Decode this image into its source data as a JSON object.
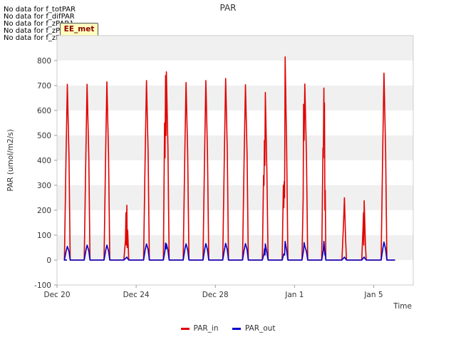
{
  "notices": [
    "No data for f_totPAR",
    "No data for f_difPAR",
    "No data for f_zPAR1",
    "No data for f_zPAR2",
    "No data for f_zPAR3"
  ],
  "badge": "EE_met",
  "chart_data": {
    "type": "line",
    "title": "PAR",
    "xlabel": "Time",
    "ylabel": "PAR (umol/m2/s)",
    "xlim": [
      "2022-12-20",
      "2023-01-07"
    ],
    "ylim": [
      -100,
      900
    ],
    "yticks": [
      -100,
      0,
      100,
      200,
      300,
      400,
      500,
      600,
      700,
      800
    ],
    "xticks": [
      {
        "date": "2022-12-20",
        "label": "Dec 20"
      },
      {
        "date": "2022-12-24",
        "label": "Dec 24"
      },
      {
        "date": "2022-12-28",
        "label": "Dec 28"
      },
      {
        "date": "2023-01-01",
        "label": "Jan 1"
      },
      {
        "date": "2023-01-05",
        "label": "Jan 5"
      }
    ],
    "grid": "horizontal bands",
    "legend_position": "bottom",
    "series": [
      {
        "name": "PAR_in",
        "color": "#e00000",
        "points": [
          [
            "2022-12-20 09:00",
            0
          ],
          [
            "2022-12-20 11:00",
            420
          ],
          [
            "2022-12-20 12:30",
            705
          ],
          [
            "2022-12-20 14:30",
            420
          ],
          [
            "2022-12-20 16:00",
            0
          ],
          [
            "2022-12-21 09:00",
            0
          ],
          [
            "2022-12-21 11:00",
            420
          ],
          [
            "2022-12-21 12:30",
            705
          ],
          [
            "2022-12-21 14:30",
            420
          ],
          [
            "2022-12-21 16:00",
            0
          ],
          [
            "2022-12-22 09:00",
            0
          ],
          [
            "2022-12-22 11:00",
            430
          ],
          [
            "2022-12-22 12:30",
            715
          ],
          [
            "2022-12-22 14:30",
            430
          ],
          [
            "2022-12-22 16:00",
            0
          ],
          [
            "2022-12-23 09:00",
            0
          ],
          [
            "2022-12-23 11:00",
            80
          ],
          [
            "2022-12-23 11:40",
            190
          ],
          [
            "2022-12-23 12:10",
            60
          ],
          [
            "2022-12-23 12:40",
            220
          ],
          [
            "2022-12-23 13:10",
            50
          ],
          [
            "2022-12-23 13:40",
            120
          ],
          [
            "2022-12-23 15:00",
            0
          ],
          [
            "2022-12-24 09:00",
            0
          ],
          [
            "2022-12-24 11:00",
            430
          ],
          [
            "2022-12-24 12:30",
            720
          ],
          [
            "2022-12-24 14:30",
            430
          ],
          [
            "2022-12-24 16:00",
            0
          ],
          [
            "2022-12-25 09:00",
            0
          ],
          [
            "2022-12-25 10:30",
            550
          ],
          [
            "2022-12-25 11:00",
            410
          ],
          [
            "2022-12-25 11:40",
            740
          ],
          [
            "2022-12-25 12:10",
            500
          ],
          [
            "2022-12-25 12:40",
            755
          ],
          [
            "2022-12-25 14:30",
            450
          ],
          [
            "2022-12-25 16:00",
            0
          ],
          [
            "2022-12-26 09:00",
            0
          ],
          [
            "2022-12-26 11:00",
            430
          ],
          [
            "2022-12-26 12:30",
            712
          ],
          [
            "2022-12-26 14:30",
            430
          ],
          [
            "2022-12-26 16:00",
            0
          ],
          [
            "2022-12-27 09:00",
            0
          ],
          [
            "2022-12-27 11:00",
            430
          ],
          [
            "2022-12-27 12:30",
            720
          ],
          [
            "2022-12-27 14:30",
            430
          ],
          [
            "2022-12-27 16:00",
            0
          ],
          [
            "2022-12-28 09:00",
            0
          ],
          [
            "2022-12-28 11:00",
            440
          ],
          [
            "2022-12-28 12:30",
            728
          ],
          [
            "2022-12-28 14:30",
            440
          ],
          [
            "2022-12-28 16:00",
            0
          ],
          [
            "2022-12-29 09:00",
            0
          ],
          [
            "2022-12-29 11:00",
            420
          ],
          [
            "2022-12-29 12:30",
            703
          ],
          [
            "2022-12-29 14:30",
            420
          ],
          [
            "2022-12-29 16:00",
            0
          ],
          [
            "2022-12-30 09:00",
            0
          ],
          [
            "2022-12-30 10:30",
            340
          ],
          [
            "2022-12-30 11:00",
            300
          ],
          [
            "2022-12-30 11:30",
            480
          ],
          [
            "2022-12-30 12:00",
            380
          ],
          [
            "2022-12-30 12:40",
            672
          ],
          [
            "2022-12-30 14:30",
            350
          ],
          [
            "2022-12-30 16:00",
            0
          ],
          [
            "2022-12-31 09:00",
            0
          ],
          [
            "2022-12-31 10:30",
            300
          ],
          [
            "2022-12-31 11:00",
            210
          ],
          [
            "2022-12-31 11:30",
            315
          ],
          [
            "2022-12-31 12:00",
            250
          ],
          [
            "2022-12-31 12:40",
            815
          ],
          [
            "2022-12-31 14:30",
            450
          ],
          [
            "2022-12-31 16:00",
            0
          ],
          [
            "2023-01-01 09:00",
            0
          ],
          [
            "2023-01-01 10:30",
            250
          ],
          [
            "2023-01-01 11:00",
            625
          ],
          [
            "2023-01-01 11:40",
            480
          ],
          [
            "2023-01-01 12:30",
            706
          ],
          [
            "2023-01-01 14:30",
            420
          ],
          [
            "2023-01-01 16:00",
            0
          ],
          [
            "2023-01-02 09:00",
            0
          ],
          [
            "2023-01-02 10:30",
            450
          ],
          [
            "2023-01-02 11:00",
            410
          ],
          [
            "2023-01-02 11:40",
            690
          ],
          [
            "2023-01-02 12:00",
            460
          ],
          [
            "2023-01-02 12:20",
            630
          ],
          [
            "2023-01-02 12:50",
            200
          ],
          [
            "2023-01-02 13:20",
            280
          ],
          [
            "2023-01-02 14:00",
            0
          ],
          [
            "2023-01-03 09:30",
            0
          ],
          [
            "2023-01-03 11:30",
            150
          ],
          [
            "2023-01-03 12:30",
            250
          ],
          [
            "2023-01-03 14:00",
            80
          ],
          [
            "2023-01-03 15:00",
            0
          ],
          [
            "2023-01-04 09:30",
            0
          ],
          [
            "2023-01-04 11:00",
            120
          ],
          [
            "2023-01-04 11:40",
            190
          ],
          [
            "2023-01-04 12:00",
            60
          ],
          [
            "2023-01-04 12:30",
            238
          ],
          [
            "2023-01-04 14:00",
            60
          ],
          [
            "2023-01-04 15:00",
            0
          ],
          [
            "2023-01-05 09:00",
            0
          ],
          [
            "2023-01-05 11:00",
            450
          ],
          [
            "2023-01-05 12:30",
            750
          ],
          [
            "2023-01-05 14:30",
            440
          ],
          [
            "2023-01-05 16:00",
            0
          ]
        ]
      },
      {
        "name": "PAR_out",
        "color": "#0000cc",
        "points": [
          [
            "2022-12-20 09:00",
            0
          ],
          [
            "2022-12-20 11:00",
            35
          ],
          [
            "2022-12-20 12:30",
            55
          ],
          [
            "2022-12-20 14:30",
            35
          ],
          [
            "2022-12-20 16:00",
            0
          ],
          [
            "2022-12-21 09:00",
            0
          ],
          [
            "2022-12-21 11:00",
            38
          ],
          [
            "2022-12-21 12:30",
            60
          ],
          [
            "2022-12-21 14:30",
            38
          ],
          [
            "2022-12-21 16:00",
            0
          ],
          [
            "2022-12-22 09:00",
            0
          ],
          [
            "2022-12-22 11:00",
            38
          ],
          [
            "2022-12-22 12:30",
            60
          ],
          [
            "2022-12-22 14:30",
            38
          ],
          [
            "2022-12-22 16:00",
            0
          ],
          [
            "2022-12-23 09:00",
            0
          ],
          [
            "2022-12-23 11:30",
            8
          ],
          [
            "2022-12-23 12:40",
            12
          ],
          [
            "2022-12-23 14:00",
            5
          ],
          [
            "2022-12-23 15:00",
            0
          ],
          [
            "2022-12-24 09:00",
            0
          ],
          [
            "2022-12-24 11:00",
            42
          ],
          [
            "2022-12-24 12:30",
            65
          ],
          [
            "2022-12-24 14:30",
            42
          ],
          [
            "2022-12-24 16:00",
            0
          ],
          [
            "2022-12-25 09:00",
            0
          ],
          [
            "2022-12-25 11:00",
            40
          ],
          [
            "2022-12-25 11:40",
            68
          ],
          [
            "2022-12-25 12:10",
            45
          ],
          [
            "2022-12-25 12:40",
            65
          ],
          [
            "2022-12-25 14:30",
            40
          ],
          [
            "2022-12-25 16:00",
            0
          ],
          [
            "2022-12-26 09:00",
            0
          ],
          [
            "2022-12-26 11:00",
            42
          ],
          [
            "2022-12-26 12:30",
            65
          ],
          [
            "2022-12-26 14:30",
            42
          ],
          [
            "2022-12-26 16:00",
            0
          ],
          [
            "2022-12-27 09:00",
            0
          ],
          [
            "2022-12-27 11:00",
            42
          ],
          [
            "2022-12-27 12:30",
            66
          ],
          [
            "2022-12-27 14:30",
            42
          ],
          [
            "2022-12-27 16:00",
            0
          ],
          [
            "2022-12-28 09:00",
            0
          ],
          [
            "2022-12-28 11:00",
            42
          ],
          [
            "2022-12-28 12:30",
            67
          ],
          [
            "2022-12-28 14:30",
            42
          ],
          [
            "2022-12-28 16:00",
            0
          ],
          [
            "2022-12-29 09:00",
            0
          ],
          [
            "2022-12-29 11:00",
            42
          ],
          [
            "2022-12-29 12:30",
            66
          ],
          [
            "2022-12-29 14:30",
            42
          ],
          [
            "2022-12-29 16:00",
            0
          ],
          [
            "2022-12-30 09:00",
            0
          ],
          [
            "2022-12-30 11:00",
            25
          ],
          [
            "2022-12-30 11:40",
            45
          ],
          [
            "2022-12-30 12:10",
            20
          ],
          [
            "2022-12-30 12:40",
            65
          ],
          [
            "2022-12-30 14:30",
            30
          ],
          [
            "2022-12-30 16:00",
            0
          ],
          [
            "2022-12-31 09:00",
            0
          ],
          [
            "2022-12-31 11:00",
            25
          ],
          [
            "2022-12-31 12:00",
            20
          ],
          [
            "2022-12-31 12:40",
            75
          ],
          [
            "2022-12-31 14:30",
            40
          ],
          [
            "2022-12-31 16:00",
            0
          ],
          [
            "2023-01-01 09:00",
            0
          ],
          [
            "2023-01-01 11:00",
            40
          ],
          [
            "2023-01-01 11:40",
            70
          ],
          [
            "2023-01-01 12:30",
            55
          ],
          [
            "2023-01-01 14:30",
            35
          ],
          [
            "2023-01-01 16:00",
            0
          ],
          [
            "2023-01-02 09:00",
            0
          ],
          [
            "2023-01-02 11:00",
            40
          ],
          [
            "2023-01-02 11:40",
            75
          ],
          [
            "2023-01-02 12:20",
            45
          ],
          [
            "2023-01-02 12:50",
            20
          ],
          [
            "2023-01-02 13:20",
            30
          ],
          [
            "2023-01-02 14:00",
            0
          ],
          [
            "2023-01-03 09:30",
            0
          ],
          [
            "2023-01-03 12:30",
            12
          ],
          [
            "2023-01-03 15:00",
            0
          ],
          [
            "2023-01-04 09:30",
            0
          ],
          [
            "2023-01-04 12:30",
            12
          ],
          [
            "2023-01-04 15:00",
            0
          ],
          [
            "2023-01-05 09:00",
            0
          ],
          [
            "2023-01-05 11:00",
            45
          ],
          [
            "2023-01-05 12:30",
            72
          ],
          [
            "2023-01-05 14:30",
            45
          ],
          [
            "2023-01-05 16:00",
            0
          ]
        ]
      }
    ]
  }
}
